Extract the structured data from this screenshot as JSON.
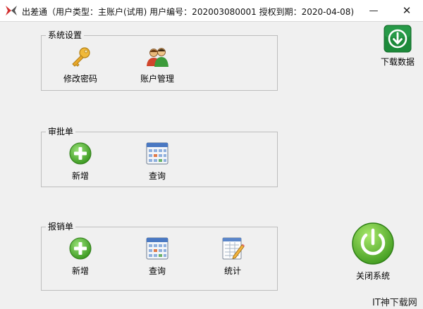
{
  "window": {
    "title": "出差通（用户类型：主账户(试用)  用户编号：202003080001  授权到期：2020-04-08)",
    "minimize_glyph": "—",
    "close_glyph": "✕"
  },
  "groups": {
    "system": {
      "title": "系统设置",
      "items": [
        {
          "label": "修改密码",
          "icon": "key-icon"
        },
        {
          "label": "账户管理",
          "icon": "users-icon"
        }
      ]
    },
    "approval": {
      "title": "审批单",
      "items": [
        {
          "label": "新增",
          "icon": "plus-circle-icon"
        },
        {
          "label": "查询",
          "icon": "calendar-grid-icon"
        }
      ]
    },
    "reimburse": {
      "title": "报销单",
      "items": [
        {
          "label": "新增",
          "icon": "plus-circle-icon"
        },
        {
          "label": "查询",
          "icon": "calendar-grid-icon"
        },
        {
          "label": "统计",
          "icon": "report-pencil-icon"
        }
      ]
    }
  },
  "actions": {
    "download_label": "下载数据",
    "close_system_label": "关闭系统"
  },
  "watermark": "IT神下载网",
  "colors": {
    "accent_green": "#4aa62f",
    "download_green": "#1c8a3a"
  }
}
